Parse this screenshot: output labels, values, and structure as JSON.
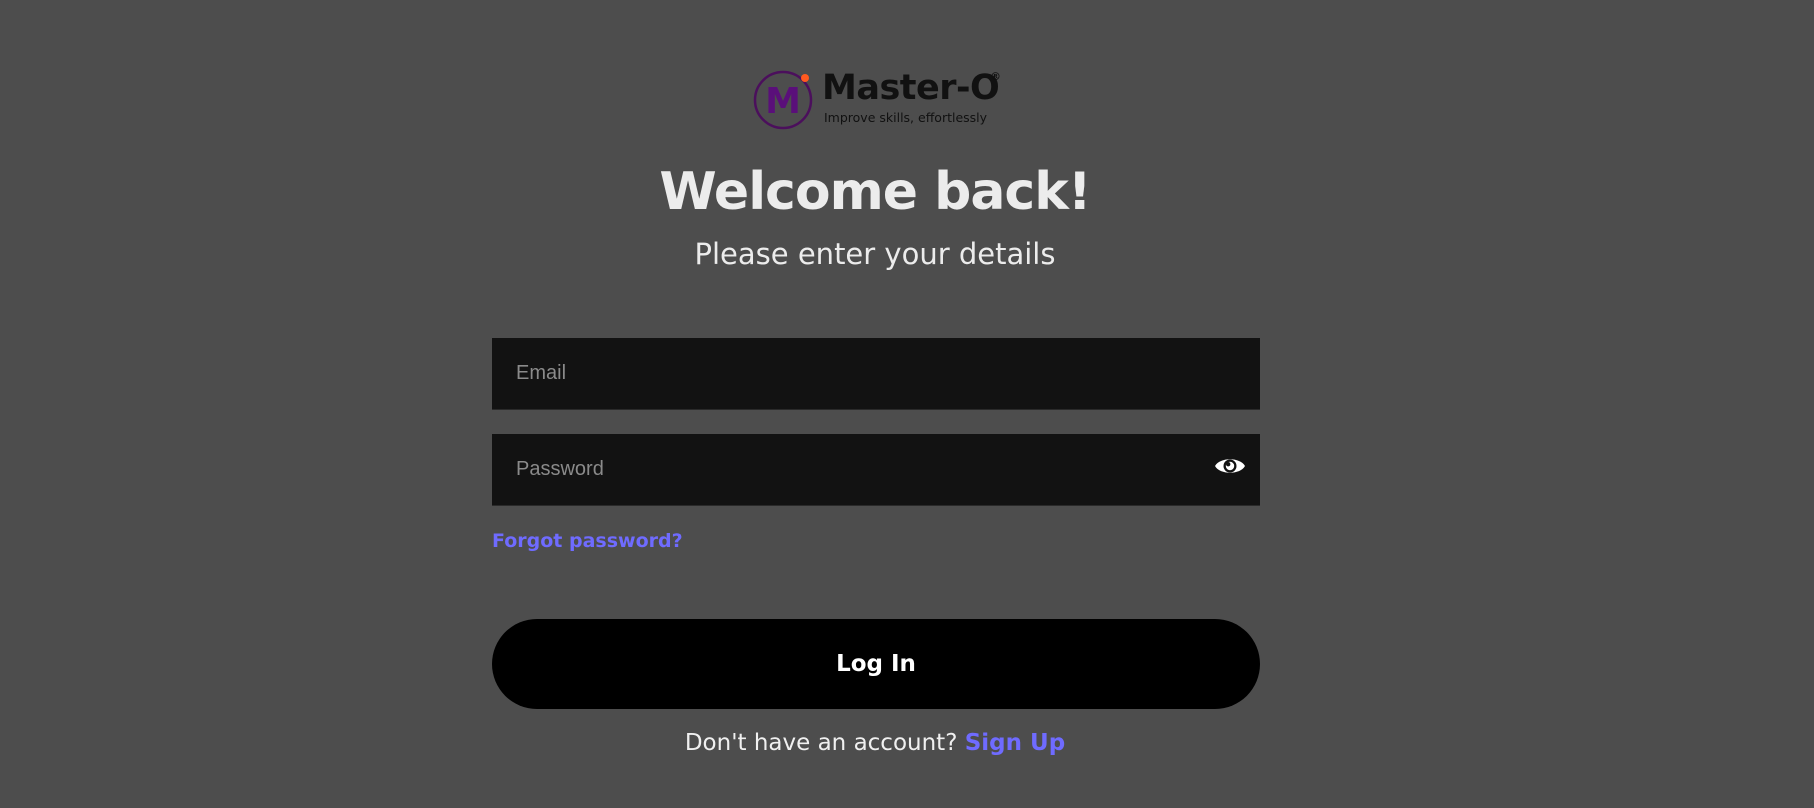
{
  "brand": {
    "name": "Master-O",
    "registered_mark": "®",
    "tagline": "Improve skills, effortlessly",
    "logo_letter": "M",
    "logo_colors": {
      "ring": "#4b0f5c",
      "letter": "#5a0f7a",
      "dot": "#ff5a1f"
    }
  },
  "heading": {
    "title": "Welcome back!",
    "subtitle": "Please enter your details"
  },
  "form": {
    "email": {
      "placeholder": "Email",
      "value": ""
    },
    "password": {
      "placeholder": "Password",
      "value": "",
      "toggle_icon": "eye-icon"
    },
    "forgot_label": "Forgot password?",
    "login_label": "Log In"
  },
  "signup": {
    "prompt": "Don't have an account?",
    "link_label": "Sign Up"
  },
  "colors": {
    "background": "#4d4d4d",
    "input_bg": "#121212",
    "accent_link": "#6f6bff",
    "button_bg": "#000000"
  }
}
